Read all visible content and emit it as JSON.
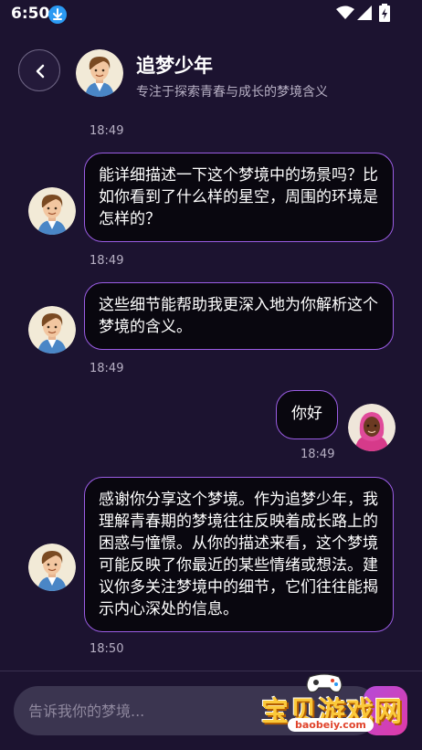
{
  "status_bar": {
    "time": "6:50",
    "icons": [
      "download-icon",
      "wifi-icon",
      "signal-icon",
      "battery-icon"
    ]
  },
  "header": {
    "title": "追梦少年",
    "subtitle": "专注于探索青春与成长的梦境含义"
  },
  "messages": [
    {
      "role": "bot",
      "text": "",
      "time": "18:49"
    },
    {
      "role": "bot",
      "text": "能详细描述一下这个梦境中的场景吗？比如你看到了什么样的星空，周围的环境是怎样的？",
      "time": "18:49"
    },
    {
      "role": "bot",
      "text": "这些细节能帮助我更深入地为你解析这个梦境的含义。",
      "time": "18:49"
    },
    {
      "role": "user",
      "text": "你好",
      "time": "18:49"
    },
    {
      "role": "bot",
      "text": "感谢你分享这个梦境。作为追梦少年，我理解青春期的梦境往往反映着成长路上的困惑与憧憬。从你的描述来看，这个梦境可能反映了你最近的某些情绪或想法。建议你多关注梦境中的细节，它们往往能揭示内心深处的信息。",
      "time": "18:50"
    }
  ],
  "input": {
    "placeholder": "告诉我你的梦境..."
  },
  "watermark": {
    "text": "宝贝游戏网",
    "url": "baobeiy.com"
  },
  "colors": {
    "background": "#1c1330",
    "bubble_border": "#9b5de5",
    "bubble_fill": "#09070f",
    "timestamp": "#b7b0c4",
    "send_button": "#c844c4"
  }
}
